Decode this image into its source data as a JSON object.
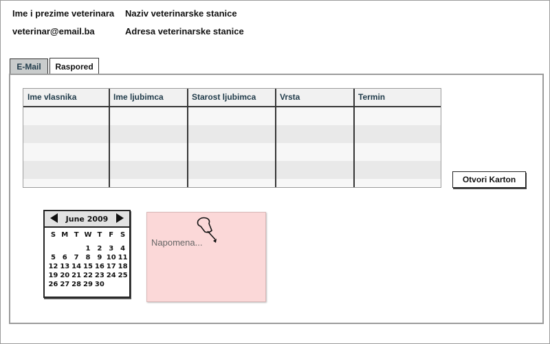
{
  "header": {
    "vet_name": "Ime i prezime veterinara",
    "vet_email": "veterinar@email.ba",
    "station_name": "Naziv veterinarske stanice",
    "station_address": "Adresa veterinarske stanice"
  },
  "tabs": [
    {
      "label": "E-Mail",
      "selected": false
    },
    {
      "label": "Raspored",
      "selected": true
    }
  ],
  "table": {
    "columns": [
      "Ime vlasnika",
      "Ime ljubimca",
      "Starost ljubimca",
      "Vrsta",
      "Termin"
    ],
    "rows": [
      [
        "",
        "",
        "",
        "",
        ""
      ],
      [
        "",
        "",
        "",
        "",
        ""
      ],
      [
        "",
        "",
        "",
        "",
        ""
      ],
      [
        "",
        "",
        "",
        "",
        ""
      ],
      [
        "",
        "",
        "",
        "",
        ""
      ]
    ]
  },
  "open_record_button": "Otvori Karton",
  "calendar": {
    "month_label": "June 2009",
    "weekdays": [
      "S",
      "M",
      "T",
      "W",
      "T",
      "F",
      "S"
    ],
    "weeks": [
      [
        "",
        "",
        "",
        "1",
        "2",
        "3",
        "4"
      ],
      [
        "5",
        "6",
        "7",
        "8",
        "9",
        "10",
        "11"
      ],
      [
        "12",
        "13",
        "14",
        "15",
        "16",
        "17",
        "18"
      ],
      [
        "19",
        "20",
        "21",
        "22",
        "23",
        "24",
        "25"
      ],
      [
        "26",
        "27",
        "28",
        "29",
        "30",
        "",
        ""
      ]
    ]
  },
  "note": {
    "placeholder": "Napomena..."
  },
  "icons": {
    "pin": "pushpin-icon",
    "prev": "triangle-left-icon",
    "next": "triangle-right-icon"
  }
}
